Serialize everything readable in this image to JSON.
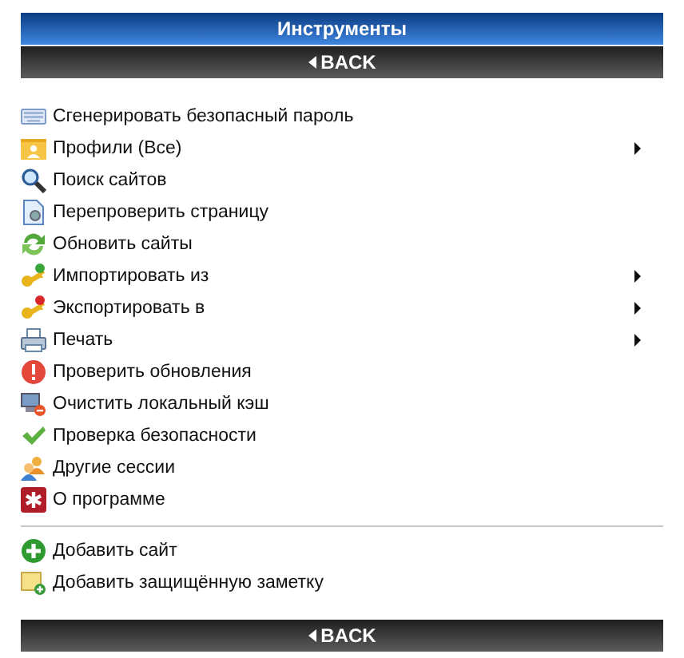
{
  "title": "Инструменты",
  "back_top": "BACK",
  "groups": [
    [
      {
        "label": "Сгенерировать безопасный пароль",
        "submenu": false
      },
      {
        "label": "Профили (Все)",
        "submenu": true
      },
      {
        "label": "Поиск сайтов",
        "submenu": false
      },
      {
        "label": "Перепроверить страницу",
        "submenu": false
      },
      {
        "label": "Обновить сайты",
        "submenu": false
      },
      {
        "label": "Импортировать из",
        "submenu": true
      },
      {
        "label": "Экспортировать в",
        "submenu": true
      },
      {
        "label": "Печать",
        "submenu": true
      },
      {
        "label": "Проверить обновления",
        "submenu": false
      },
      {
        "label": "Очистить локальный кэш",
        "submenu": false
      },
      {
        "label": "Проверка безопасности",
        "submenu": false
      },
      {
        "label": "Другие сессии",
        "submenu": false
      },
      {
        "label": "О программе",
        "submenu": false
      }
    ],
    [
      {
        "label": "Добавить сайт",
        "submenu": false
      },
      {
        "label": "Добавить защищённую заметку",
        "submenu": false
      }
    ]
  ],
  "back_bottom": "BACK"
}
